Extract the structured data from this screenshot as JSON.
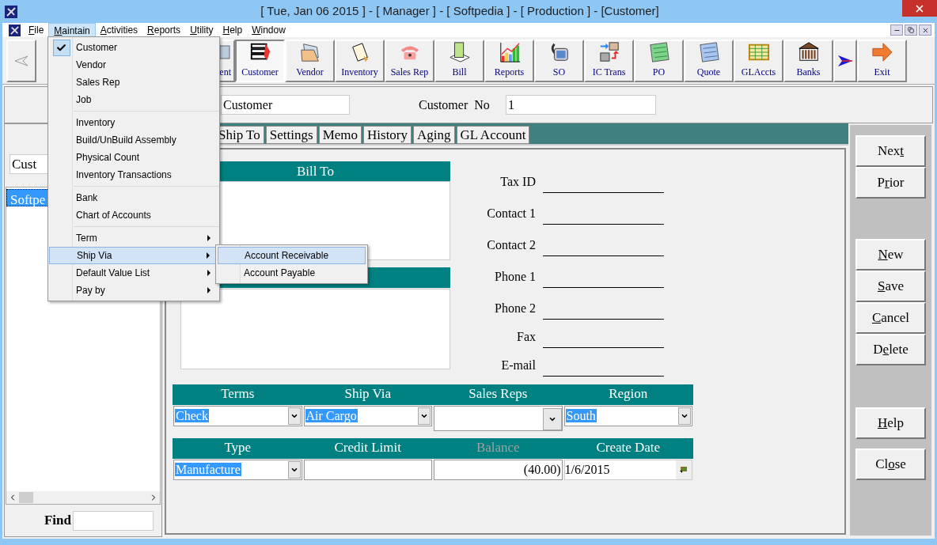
{
  "window": {
    "title": "[ Tue, Jan 06 2015 ] - [ Manager ] - [ Softpedia ] - [ Production ] - [Customer]"
  },
  "menu_bar": [
    {
      "key": "F",
      "post": "ile",
      "selected": false
    },
    {
      "key": "M",
      "post": "aintain",
      "selected": true
    },
    {
      "key": "A",
      "post": "ctivities",
      "selected": false
    },
    {
      "key": "R",
      "post": "eports",
      "selected": false
    },
    {
      "key": "U",
      "post": "tility",
      "selected": false
    },
    {
      "key": "H",
      "post": "elp",
      "selected": false
    },
    {
      "key": "W",
      "post": "indow",
      "selected": false
    }
  ],
  "maintain_menu": {
    "groups": [
      [
        {
          "label": "Customer",
          "checked": true,
          "submenu": false,
          "selected": false
        },
        {
          "label": "Vendor",
          "checked": false,
          "submenu": false,
          "selected": false
        },
        {
          "label": "Sales Rep",
          "checked": false,
          "submenu": false,
          "selected": false
        },
        {
          "label": "Job",
          "checked": false,
          "submenu": false,
          "selected": false
        }
      ],
      [
        {
          "label": "Inventory",
          "checked": false,
          "submenu": false,
          "selected": false
        },
        {
          "label": "Build/UnBuild Assembly",
          "checked": false,
          "submenu": false,
          "selected": false
        },
        {
          "label": "Physical Count",
          "checked": false,
          "submenu": false,
          "selected": false
        },
        {
          "label": "Inventory Transactions",
          "checked": false,
          "submenu": false,
          "selected": false
        }
      ],
      [
        {
          "label": "Bank",
          "checked": false,
          "submenu": false,
          "selected": false
        },
        {
          "label": "Chart of Accounts",
          "checked": false,
          "submenu": false,
          "selected": false
        }
      ],
      [
        {
          "label": "Term",
          "checked": false,
          "submenu": true,
          "selected": false
        },
        {
          "label": "Ship Via",
          "checked": false,
          "submenu": true,
          "selected": true
        },
        {
          "label": "Default Value List",
          "checked": false,
          "submenu": true,
          "selected": false
        },
        {
          "label": "Pay by",
          "checked": false,
          "submenu": true,
          "selected": false
        }
      ]
    ]
  },
  "submenu": [
    {
      "label": "Account Receivable",
      "selected": true
    },
    {
      "label": "Account Payable",
      "selected": false
    }
  ],
  "toolbar": [
    {
      "label": "ent",
      "selected": false
    },
    {
      "label": "Customer",
      "selected": true
    },
    {
      "label": "Vendor",
      "selected": false
    },
    {
      "label": "Inventory",
      "selected": false
    },
    {
      "label": "Sales Rep",
      "selected": false
    },
    {
      "label": "Bill",
      "selected": false
    },
    {
      "label": "Reports",
      "selected": false
    },
    {
      "label": "SO",
      "selected": false
    },
    {
      "label": "IC Trans",
      "selected": false
    },
    {
      "label": "PO",
      "selected": false
    },
    {
      "label": "Quote",
      "selected": false
    },
    {
      "label": "GLAccts",
      "selected": false
    },
    {
      "label": "Banks",
      "selected": false
    },
    {
      "label": "Exit",
      "selected": false
    }
  ],
  "header": {
    "name_value": "Customer",
    "number_label": "Customer  No",
    "number_value": "1"
  },
  "sidebar": {
    "search_value": "Cust",
    "items": [
      {
        "label": "Softpe",
        "selected": true
      }
    ],
    "find_label": "Find"
  },
  "tabs": [
    {
      "label": "Ship To",
      "selected": false
    },
    {
      "label": "Settings",
      "selected": false
    },
    {
      "label": "Memo",
      "selected": false
    },
    {
      "label": "History",
      "selected": false
    },
    {
      "label": "Aging",
      "selected": false
    },
    {
      "label": "GL Account",
      "selected": false
    }
  ],
  "bill_to": {
    "title": "Bill To"
  },
  "contact_fields": [
    {
      "label": "Tax ID"
    },
    {
      "label": "Contact 1"
    },
    {
      "label": "Contact 2"
    },
    {
      "label": "Phone 1"
    },
    {
      "label": "Phone 2"
    },
    {
      "label": "Fax"
    },
    {
      "label": "E-mail"
    }
  ],
  "grid_rows": [
    [
      {
        "label": "Terms",
        "kind": "combo",
        "value": "Check",
        "highlighted": true,
        "disabled": false
      },
      {
        "label": "Ship Via",
        "kind": "combo",
        "value": "Air Cargo",
        "highlighted": true,
        "disabled": false
      },
      {
        "label": "Sales Reps",
        "kind": "tallcombo",
        "disabled": false
      },
      {
        "label": "Region",
        "kind": "combo",
        "value": "South",
        "highlighted": true,
        "disabled": false
      }
    ],
    [
      {
        "label": "Type",
        "kind": "combo",
        "value": "Manufacture",
        "highlighted": true,
        "disabled": false
      },
      {
        "label": "Credit Limit",
        "kind": "text",
        "disabled": false
      },
      {
        "label": "Balance",
        "kind": "number",
        "value": "(40.00)",
        "disabled": true
      },
      {
        "label": "Create Date",
        "kind": "date",
        "value": "1/6/2015",
        "disabled": false
      }
    ]
  ],
  "action_buttons": [
    [
      {
        "pre": "Nex",
        "key": "t"
      },
      {
        "pre": "P",
        "key": "r",
        "post": "ior"
      }
    ],
    [
      {
        "key": "N",
        "post": "ew"
      },
      {
        "key": "S",
        "post": "ave"
      },
      {
        "key": "C",
        "post": "ancel"
      },
      {
        "pre": "D",
        "key": "e",
        "post": "lete"
      }
    ],
    [
      {
        "key": "H",
        "post": "elp"
      }
    ],
    [
      {
        "pre": "Cl",
        "key": "o",
        "post": "se"
      }
    ]
  ]
}
